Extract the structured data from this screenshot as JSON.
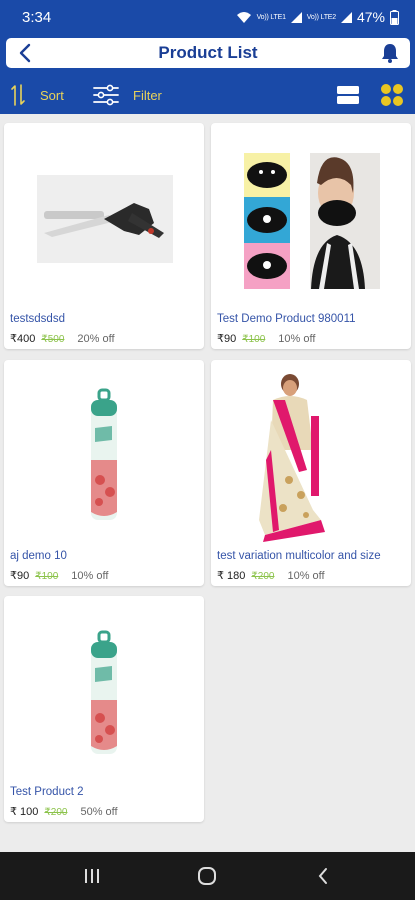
{
  "status_bar": {
    "time": "3:34",
    "volte1": "Vo)) LTE1",
    "volte2": "Vo)) LTE2",
    "battery": "47%"
  },
  "header": {
    "title": "Product List"
  },
  "toolbar": {
    "sort_label": "Sort",
    "filter_label": "Filter"
  },
  "colors": {
    "primary": "#1a4aa8",
    "accent_yellow": "#e9d35a",
    "product_name": "#3554a8",
    "mrp_green": "#8cc34b"
  },
  "products": [
    {
      "name": "testsdsdsd",
      "price": "₹400",
      "mrp": "₹500",
      "discount": "20% off",
      "image": "vegetable-scissors"
    },
    {
      "name": "Test Demo Product 980011",
      "price": "₹90",
      "mrp": "₹100",
      "discount": "10% off",
      "image": "face-masks"
    },
    {
      "name": "aj demo 10",
      "price": "₹90",
      "mrp": "₹100",
      "discount": "10% off",
      "image": "air-freshener"
    },
    {
      "name": "test variation multicolor and size",
      "price": "₹ 180",
      "mrp": "₹200",
      "discount": "10% off",
      "image": "saree"
    },
    {
      "name": "Test Product 2",
      "price": "₹ 100",
      "mrp": "₹200",
      "discount": "50% off",
      "image": "air-freshener"
    }
  ]
}
